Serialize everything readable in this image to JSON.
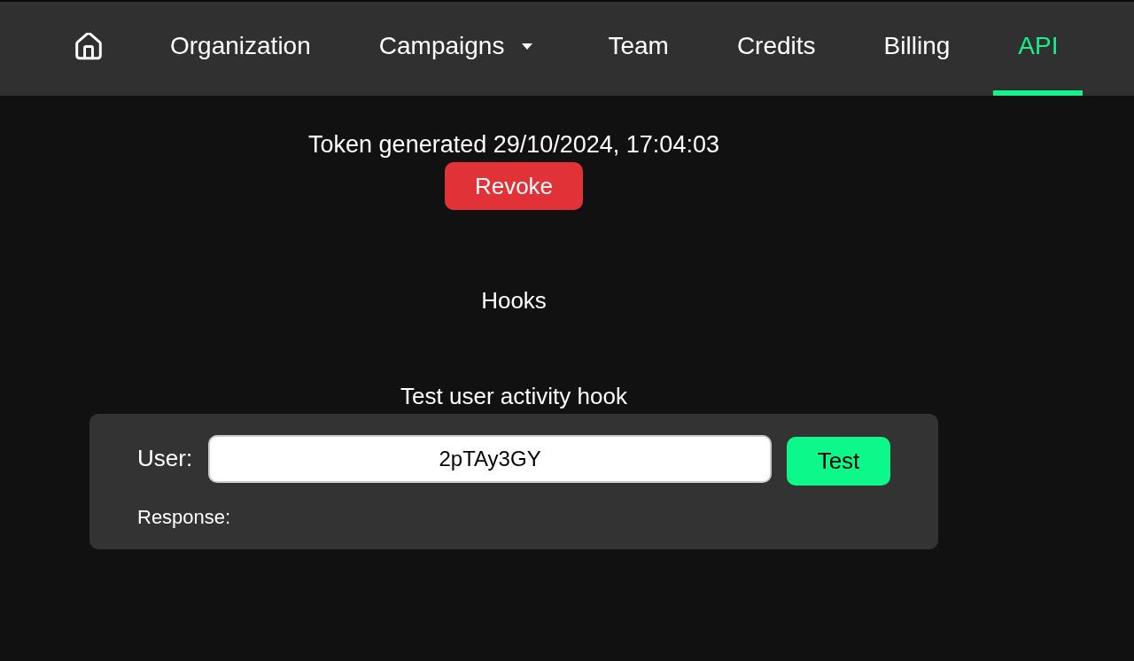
{
  "nav": {
    "items": [
      {
        "kind": "home",
        "selected": false
      },
      {
        "kind": "link",
        "label": "Organization",
        "selected": false
      },
      {
        "kind": "dropdown",
        "label": "Campaigns",
        "selected": false
      },
      {
        "kind": "link",
        "label": "Team",
        "selected": false
      },
      {
        "kind": "link",
        "label": "Credits",
        "selected": false
      },
      {
        "kind": "link",
        "label": "Billing",
        "selected": false
      },
      {
        "kind": "link",
        "label": "API",
        "selected": true
      }
    ]
  },
  "token": {
    "status": "Token generated 29/10/2024, 17:04:03",
    "revoke_button": "Revoke"
  },
  "hooks": {
    "title": "Hooks"
  },
  "test_hook": {
    "title": "Test user activity hook",
    "user_label": "User:",
    "user_value": "2pTAy3GY",
    "test_button": "Test",
    "response_label": "Response:"
  }
}
